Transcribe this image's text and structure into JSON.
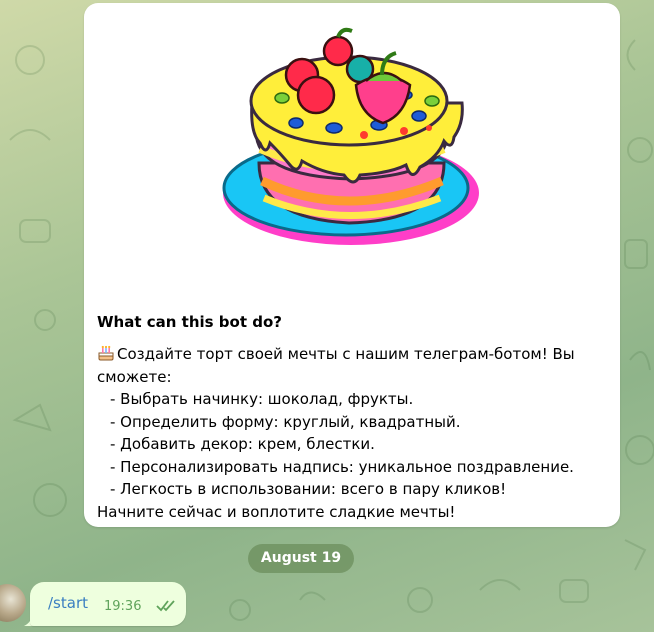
{
  "bot_card": {
    "title": "What can this bot do?",
    "description_lines": [
      "Создайте торт своей мечты с нашим телеграм-ботом! Вы",
      "сможете:",
      "- Выбрать начинку: шоколад, фрукты.",
      "- Определить форму: круглый, квадратный.",
      "- Добавить декор: крем, блестки.",
      "- Персонализировать надпись: уникальное поздравление.",
      "- Легкость в использовании: всего в пару кликов!",
      "Начните сейчас и воплотите сладкие мечты!"
    ],
    "image_icon": "cake-illustration",
    "emoji_icon": "birthday-cake-emoji"
  },
  "date_separator": "August 19",
  "message": {
    "text": "/start",
    "time": "19:36",
    "status_icon": "double-check-icon"
  },
  "colors": {
    "outgoing_bubble": "#eeffde",
    "link": "#3a7fc1",
    "time": "#5fa35b",
    "date_pill": "#7d9c6a"
  }
}
